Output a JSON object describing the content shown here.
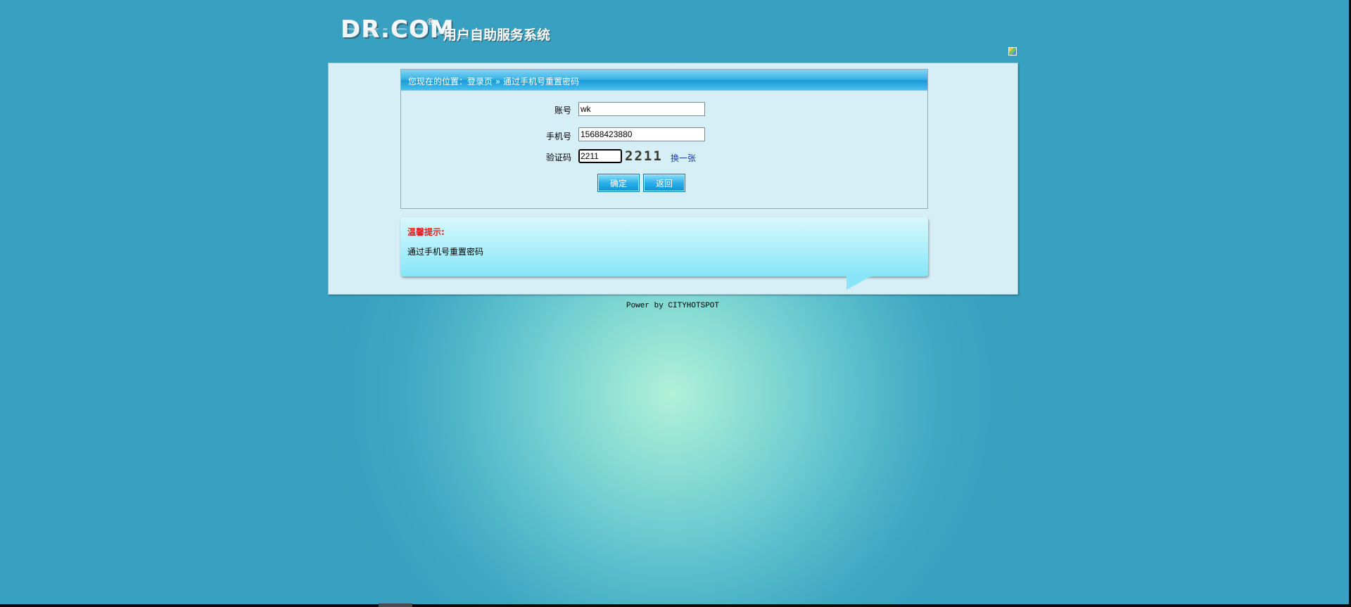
{
  "header": {
    "logo_text": "DR.COM",
    "logo_reg": "®",
    "system_title": "用户自助服务系统"
  },
  "breadcrumb": {
    "text": "您现在的位置：登录页 » 通过手机号重置密码"
  },
  "form": {
    "account_label": "账号",
    "account_value": "wk",
    "phone_label": "手机号",
    "phone_value": "15688423880",
    "captcha_label": "验证码",
    "captcha_value": "2211",
    "captcha_image_text": "2211",
    "refresh_label": "换一张",
    "confirm_label": "确定",
    "back_label": "返回"
  },
  "tip": {
    "title": "温馨提示:",
    "text": "通过手机号重置密码"
  },
  "footer": {
    "text": "Power by CITYHOTSPOT"
  },
  "colors": {
    "background": "#3aa2c2",
    "panel": "#d6eef6",
    "header_bar": "#1a9bd8",
    "tip_title": "#e01f1f",
    "link": "#1a3aa8"
  }
}
